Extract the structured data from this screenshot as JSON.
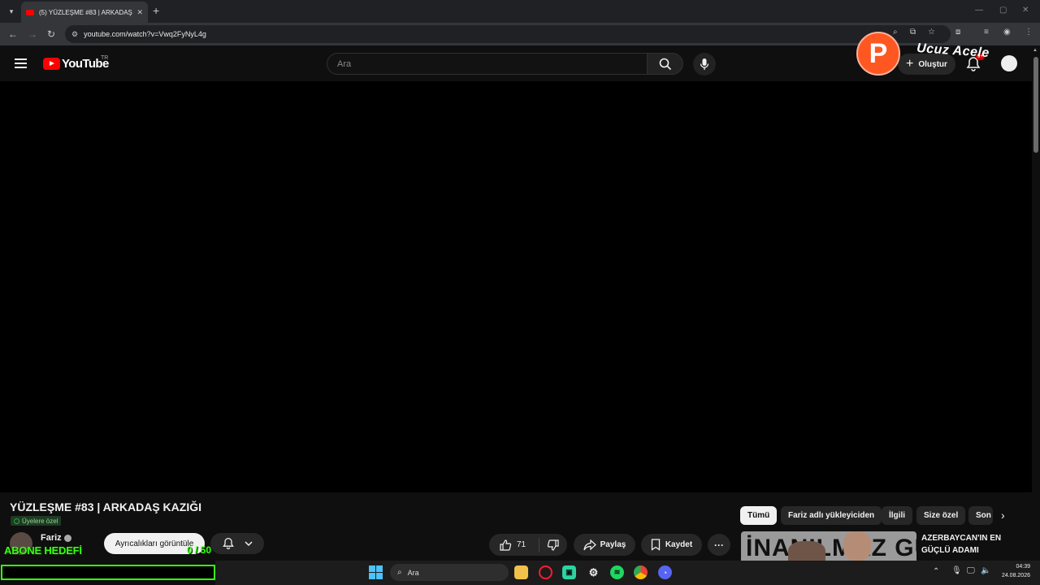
{
  "browser": {
    "tab_title": "(5) YÜZLEŞME #83 | ARKADAŞ KAZIĞI - YouTube",
    "url": "youtube.com/watch?v=Vwq2FyNyL4g"
  },
  "header": {
    "logo_text": "YouTube",
    "region": "TR",
    "search_placeholder": "Ara",
    "create_label": "Oluştur",
    "notification_count": "9+"
  },
  "overlay": {
    "logo_letter": "P",
    "wordmark": "Ucuz Acele"
  },
  "video": {
    "title": "YÜZLEŞME #83 | ARKADAŞ KAZIĞI",
    "members_badge": "Üyelere özel",
    "channel_name": "Fariz",
    "subscribed_label": "Ayrıcalıkları görüntüle",
    "like_count": "71",
    "share_label": "Paylaş",
    "save_label": "Kaydet"
  },
  "chips": [
    {
      "label": "Tümü",
      "active": true
    },
    {
      "label": "Fariz adlı yükleyiciden",
      "active": false
    },
    {
      "label": "İlgili",
      "active": false
    },
    {
      "label": "Size özel",
      "active": false
    },
    {
      "label": "Son",
      "active": false
    }
  ],
  "related": {
    "thumb_text": "İNANILMAZ GÜÇ",
    "title": "AZERBAYCAN'IN EN GÜÇLÜ ADAMI"
  },
  "stream_overlay": {
    "goal_label": "ABONE HEDEFİ",
    "goal_value": "0 / 50",
    "goal_progress": 0.0
  },
  "taskbar": {
    "search_label": "Ara",
    "time": "04:39",
    "date": "24.08.2026"
  },
  "colors": {
    "accent_red": "#ff0000",
    "goal_green": "#39ff14",
    "overlay_orange": "#ff5722"
  }
}
